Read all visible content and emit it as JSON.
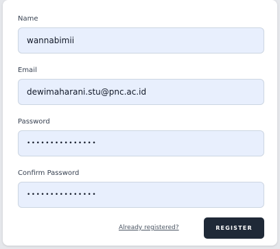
{
  "form": {
    "name_label": "Name",
    "name_value": "wannabimii",
    "email_label": "Email",
    "email_value": "dewimaharani.stu@pnc.ac.id",
    "password_label": "Password",
    "password_value": "•••••••••••••••",
    "confirm_label": "Confirm Password",
    "confirm_value": "•••••••••••••••",
    "already_link": "Already registered?",
    "register_label": "REGISTER"
  },
  "colors": {
    "input_bg": "#e8effd",
    "button_bg": "#1f2937"
  }
}
